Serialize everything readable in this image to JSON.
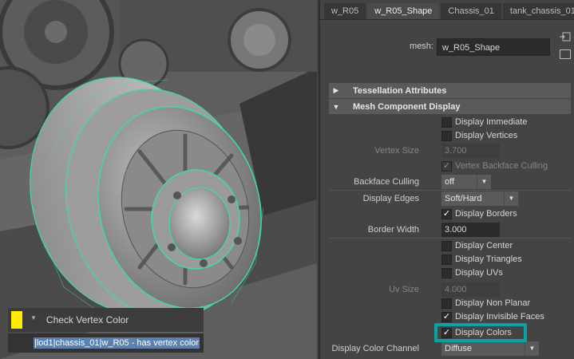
{
  "tabs": [
    "w_R05",
    "w_R05_Shape",
    "Chassis_01",
    "tank_chassis_01"
  ],
  "active_tab": "w_R05_Shape",
  "mesh": {
    "label": "mesh:",
    "value": "w_R05_Shape"
  },
  "sections": {
    "tessellation": "Tessellation Attributes",
    "mesh_component": "Mesh Component Display"
  },
  "attributes": {
    "display_immediate": "Display Immediate",
    "display_vertices": "Display Vertices",
    "vertex_size_label": "Vertex Size",
    "vertex_size_value": "3.700",
    "vertex_backface": "Vertex Backface Culling",
    "backface_label": "Backface Culling",
    "backface_value": "off",
    "display_edges_label": "Display Edges",
    "display_edges_value": "Soft/Hard",
    "display_borders": "Display Borders",
    "border_width_label": "Border Width",
    "border_width_value": "3.000",
    "display_center": "Display Center",
    "display_triangles": "Display Triangles",
    "display_uvs": "Display UVs",
    "uv_size_label": "Uv Size",
    "uv_size_value": "4.000",
    "display_non_planar": "Display Non Planar",
    "display_invisible_faces": "Display Invisible Faces",
    "display_colors": "Display Colors",
    "color_channel_label": "Display Color Channel",
    "color_channel_value": "Diffuse"
  },
  "checkmark": "✓",
  "overlay": {
    "check_label": "Check Vertex Color",
    "result_text": "|lod1|chassis_01|w_R05 - has vertex color"
  },
  "colors": {
    "highlight": "#0aa3a3",
    "swatch": "#ffee00",
    "wire": "#3fd9b0"
  }
}
